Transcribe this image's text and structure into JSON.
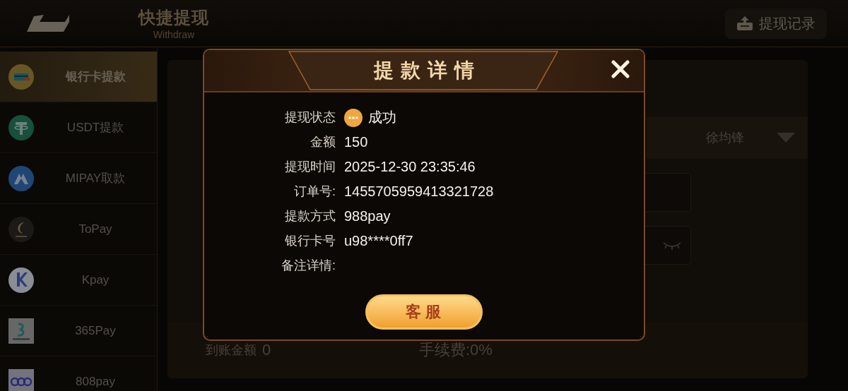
{
  "header": {
    "title": "快捷提现",
    "subtitle": "Withdraw",
    "history_button": "提现记录"
  },
  "sidebar": {
    "items": [
      {
        "label": "银行卡提款",
        "kind": "card",
        "selected": true
      },
      {
        "label": "USDT提款",
        "kind": "usdt",
        "selected": false
      },
      {
        "label": "MIPAY取款",
        "kind": "mipay",
        "selected": false
      },
      {
        "label": "ToPay",
        "kind": "topay",
        "selected": false
      },
      {
        "label": "Kpay",
        "kind": "kpay",
        "selected": false
      },
      {
        "label": "365Pay",
        "kind": "p365",
        "selected": false
      },
      {
        "label": "808pay",
        "kind": "p808",
        "selected": false
      }
    ]
  },
  "form": {
    "name_select": "徐均锋",
    "received_label": "到账金额",
    "received_value": "0",
    "fee": "手续费:0%"
  },
  "dialog": {
    "title": "提款详情",
    "rows": [
      {
        "label": "提现状态",
        "value": "成功",
        "kind": "status"
      },
      {
        "label": "金额",
        "value": "150",
        "kind": "text"
      },
      {
        "label": "提现时间",
        "value": "2025-12-30 23:35:46",
        "kind": "text"
      },
      {
        "label": "订单号:",
        "value": "1455705959413321728",
        "kind": "text"
      },
      {
        "label": "提款方式",
        "value": "988pay",
        "kind": "text"
      },
      {
        "label": "银行卡号",
        "value": "u98****0ff7",
        "kind": "text"
      },
      {
        "label": "备注详情:",
        "kind": "note"
      }
    ],
    "button": "客服"
  }
}
